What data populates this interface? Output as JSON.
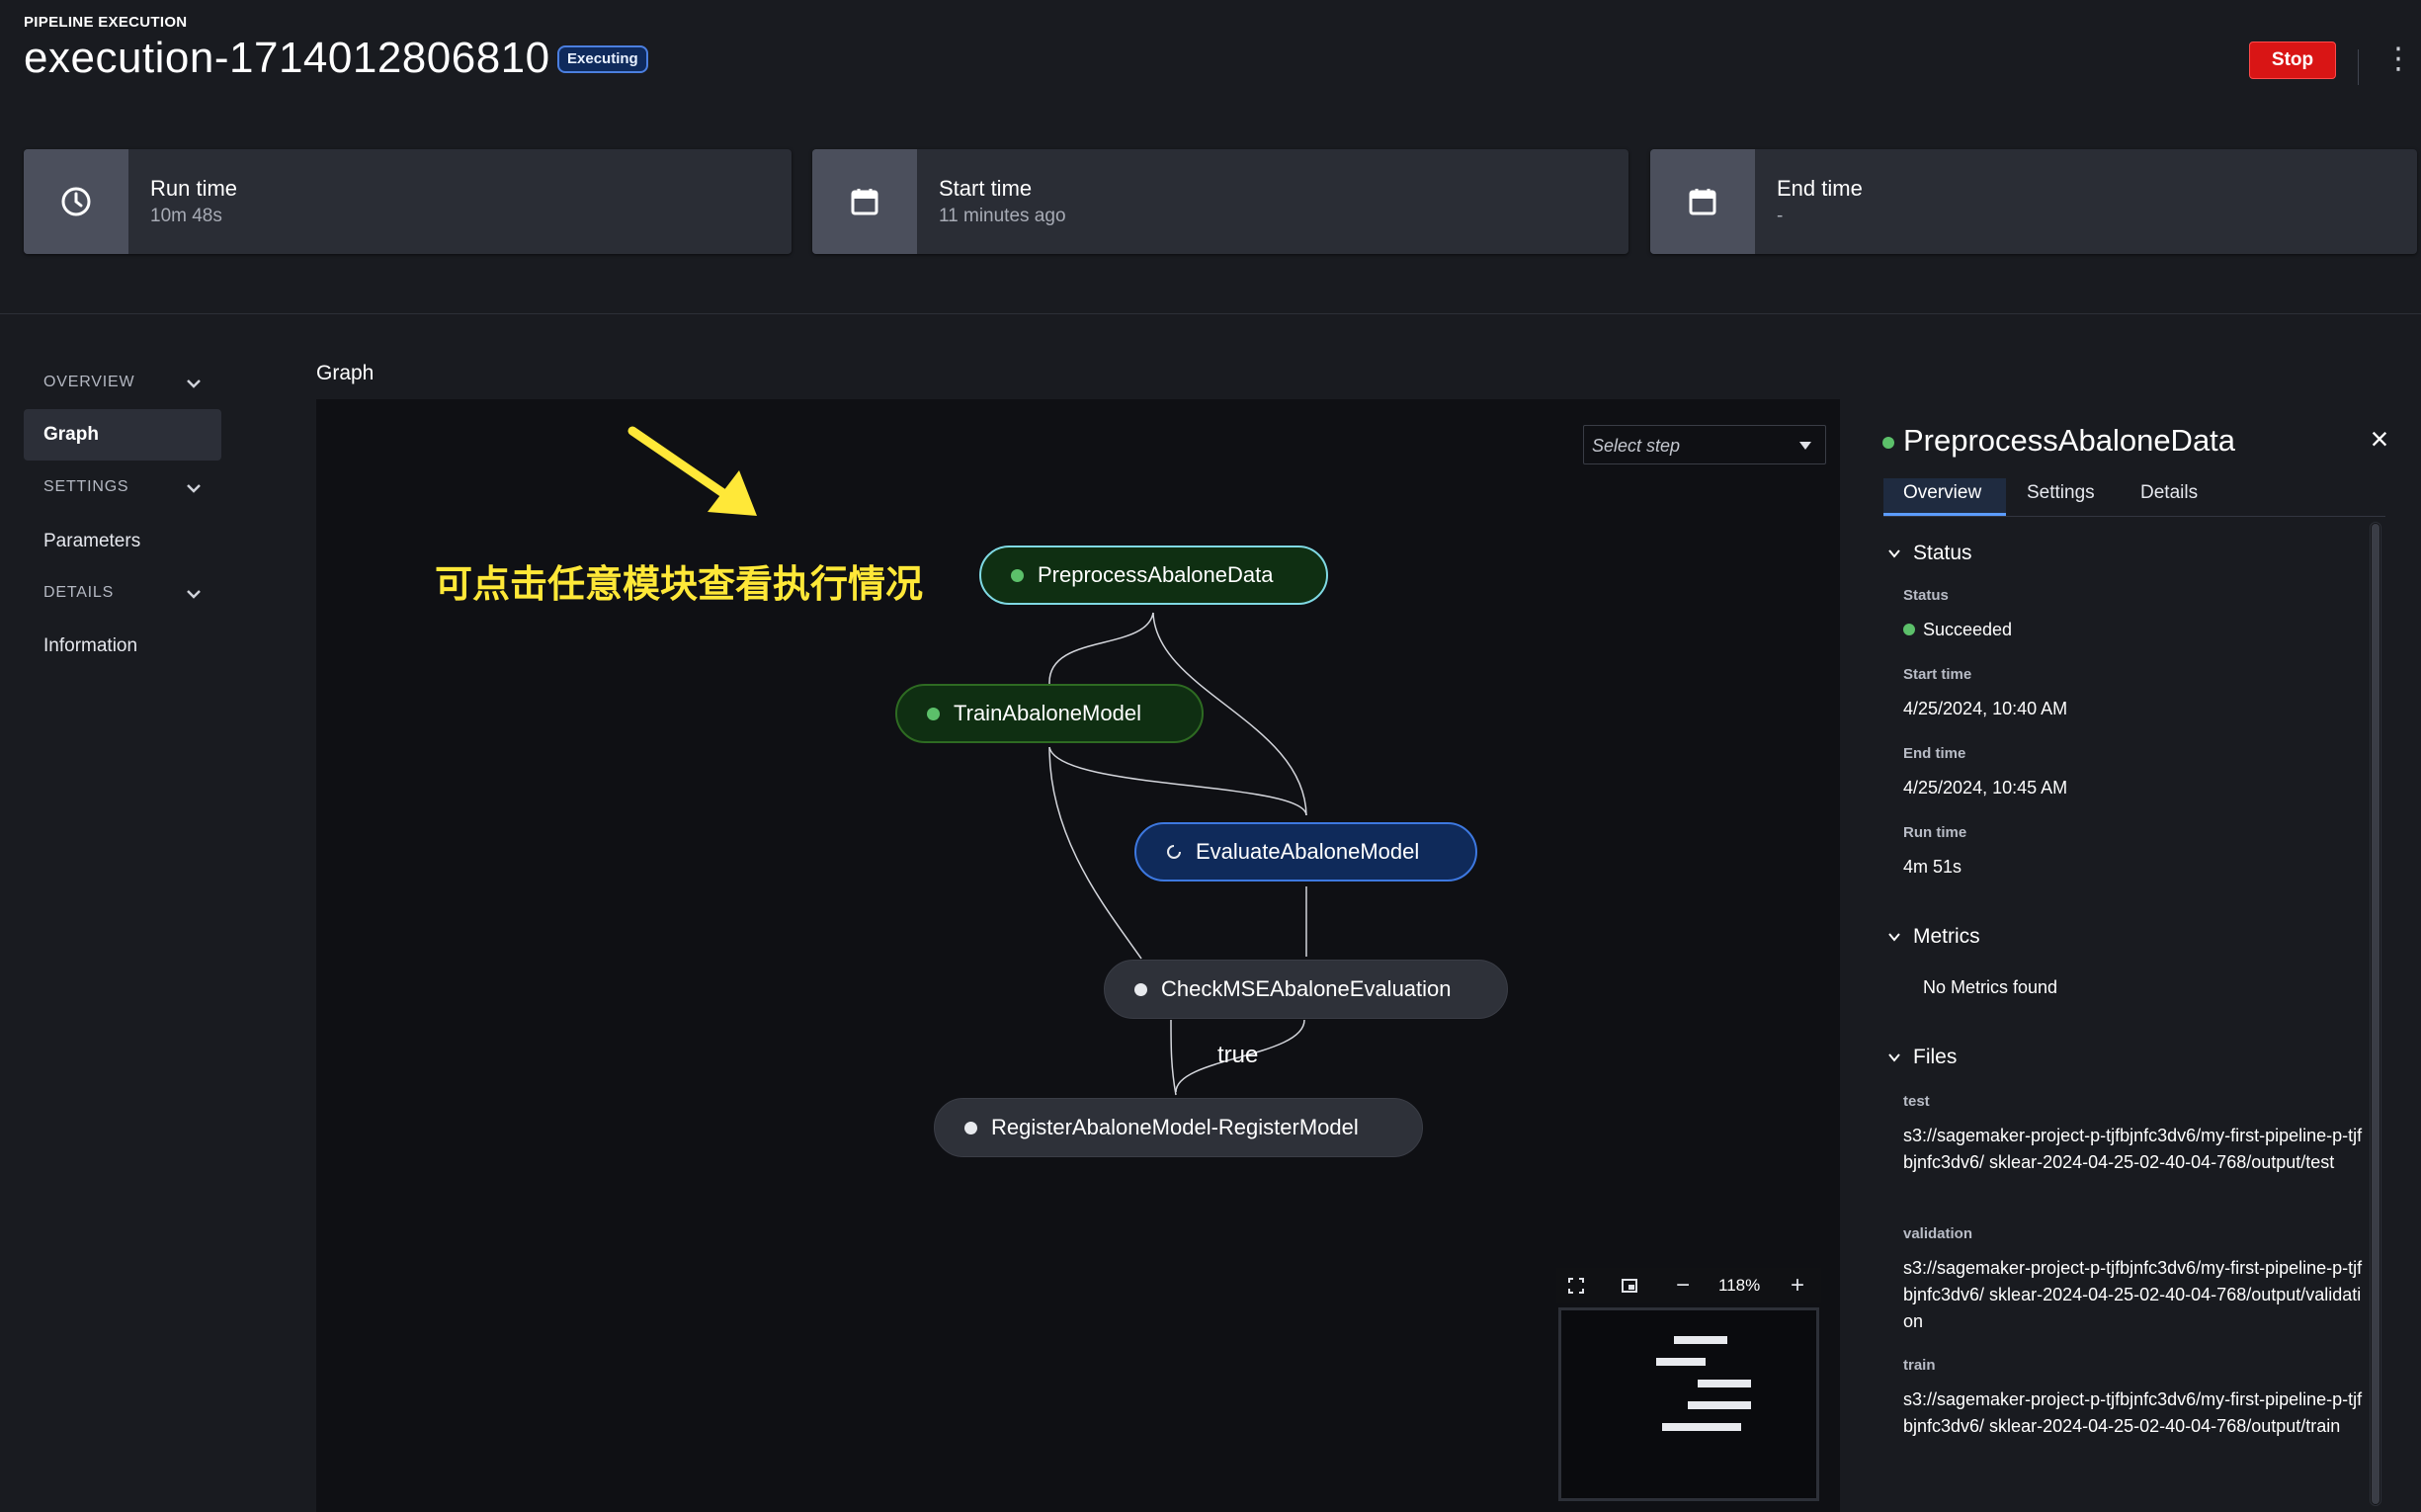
{
  "header": {
    "eyebrow": "PIPELINE EXECUTION",
    "title": "execution-1714012806810",
    "status_badge": "Executing",
    "stop_label": "Stop",
    "more_icon": "kebab-icon"
  },
  "stats": [
    {
      "label": "Run time",
      "value": "10m 48s",
      "icon": "clock-icon"
    },
    {
      "label": "Start time",
      "value": "11 minutes ago",
      "icon": "calendar-icon"
    },
    {
      "label": "End time",
      "value": "-",
      "icon": "calendar-icon"
    }
  ],
  "nav": {
    "overview": "OVERVIEW",
    "graph": "Graph",
    "settings": "SETTINGS",
    "parameters": "Parameters",
    "details": "DETAILS",
    "information": "Information"
  },
  "graph": {
    "title": "Graph",
    "select_placeholder": "Select step",
    "annotation": "可点击任意模块查看执行情况",
    "edge_label": "true",
    "zoom": "118%",
    "nodes": [
      {
        "name": "PreprocessAbaloneData",
        "state": "succeeded",
        "color": "#5cc06a"
      },
      {
        "name": "TrainAbaloneModel",
        "state": "succeeded",
        "color": "#5cc06a"
      },
      {
        "name": "EvaluateAbaloneModel",
        "state": "executing",
        "color": "#3d78e0"
      },
      {
        "name": "CheckMSEAbaloneEvaluation",
        "state": "not-started",
        "color": "#e8eaee"
      },
      {
        "name": "RegisterAbaloneModel-RegisterModel",
        "state": "not-started",
        "color": "#e8eaee"
      }
    ]
  },
  "detail": {
    "title": "PreprocessAbaloneData",
    "tabs": [
      "Overview",
      "Settings",
      "Details"
    ],
    "status_section": "Status",
    "status_label": "Status",
    "status_value": "Succeeded",
    "start_label": "Start time",
    "start_value": "4/25/2024, 10:40 AM",
    "end_label": "End time",
    "end_value": "4/25/2024, 10:45 AM",
    "runtime_label": "Run time",
    "runtime_value": "4m 51s",
    "metrics_section": "Metrics",
    "metrics_empty": "No Metrics found",
    "files_section": "Files",
    "files": [
      {
        "label": "test",
        "path": "s3://sagemaker-project-p-tjfbjnfc3dv6/my-first-pipeline-p-tjfbjnfc3dv6/ sklear-2024-04-25-02-40-04-768/output/test"
      },
      {
        "label": "validation",
        "path": "s3://sagemaker-project-p-tjfbjnfc3dv6/my-first-pipeline-p-tjfbjnfc3dv6/ sklear-2024-04-25-02-40-04-768/output/validation"
      },
      {
        "label": "train",
        "path": "s3://sagemaker-project-p-tjfbjnfc3dv6/my-first-pipeline-p-tjfbjnfc3dv6/ sklear-2024-04-25-02-40-04-768/output/train"
      }
    ]
  },
  "colors": {
    "accent": "#5c9cff",
    "success": "#5cc06a",
    "danger": "#d91515",
    "annotation": "#ffe838"
  }
}
